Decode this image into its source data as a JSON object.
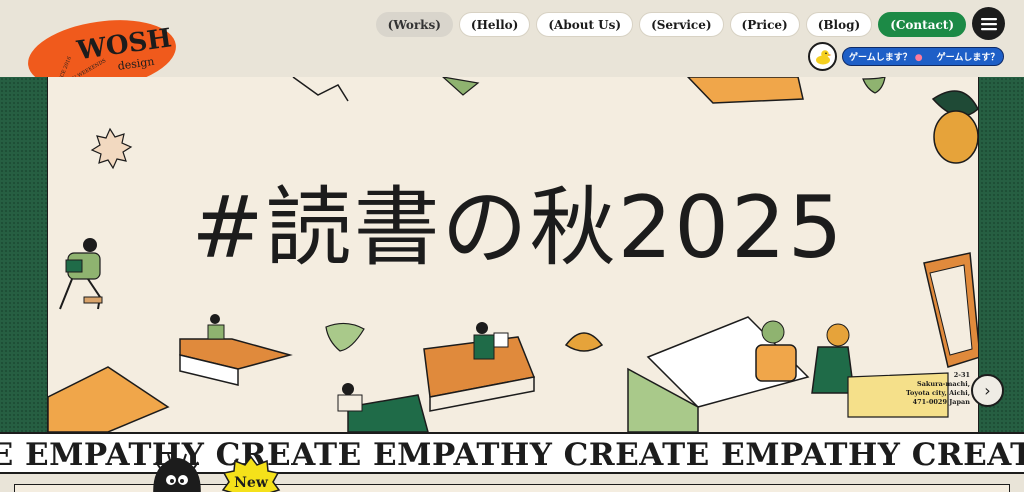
{
  "header": {
    "logo": {
      "name": "WOSH",
      "sub": "design",
      "ring_text": "WORK ON WEEKENDS",
      "since": "SINCE 2016"
    },
    "nav": [
      {
        "label": "(Works)",
        "state": "active"
      },
      {
        "label": "(Hello)"
      },
      {
        "label": "(About Us)"
      },
      {
        "label": "(Service)"
      },
      {
        "label": "(Price)"
      },
      {
        "label": "(Blog)"
      },
      {
        "label": "(Contact)",
        "state": "primary"
      }
    ],
    "menu_icon": "hamburger-icon",
    "duck_icon": "duck-icon",
    "game_marquee": [
      "ゲームします？",
      "ゲームします？"
    ]
  },
  "hero": {
    "title": "#読書の秋2025",
    "address": [
      "2-31",
      "Sakura-machi,",
      "Toyota city, Aichi,",
      "471-0029 Japan"
    ],
    "next_icon": "chevron-right-icon"
  },
  "band": {
    "text": "TE EMPATHY CREATE EMPATHY CREATE EMPATHY CREATE EMPATHY CREATE EM"
  },
  "badge": {
    "label": "New"
  },
  "colors": {
    "green": "#1c8a46",
    "dark_green": "#265f42",
    "orange": "#f05a1c",
    "cream": "#f4ede0",
    "ink": "#1c1c1c"
  }
}
